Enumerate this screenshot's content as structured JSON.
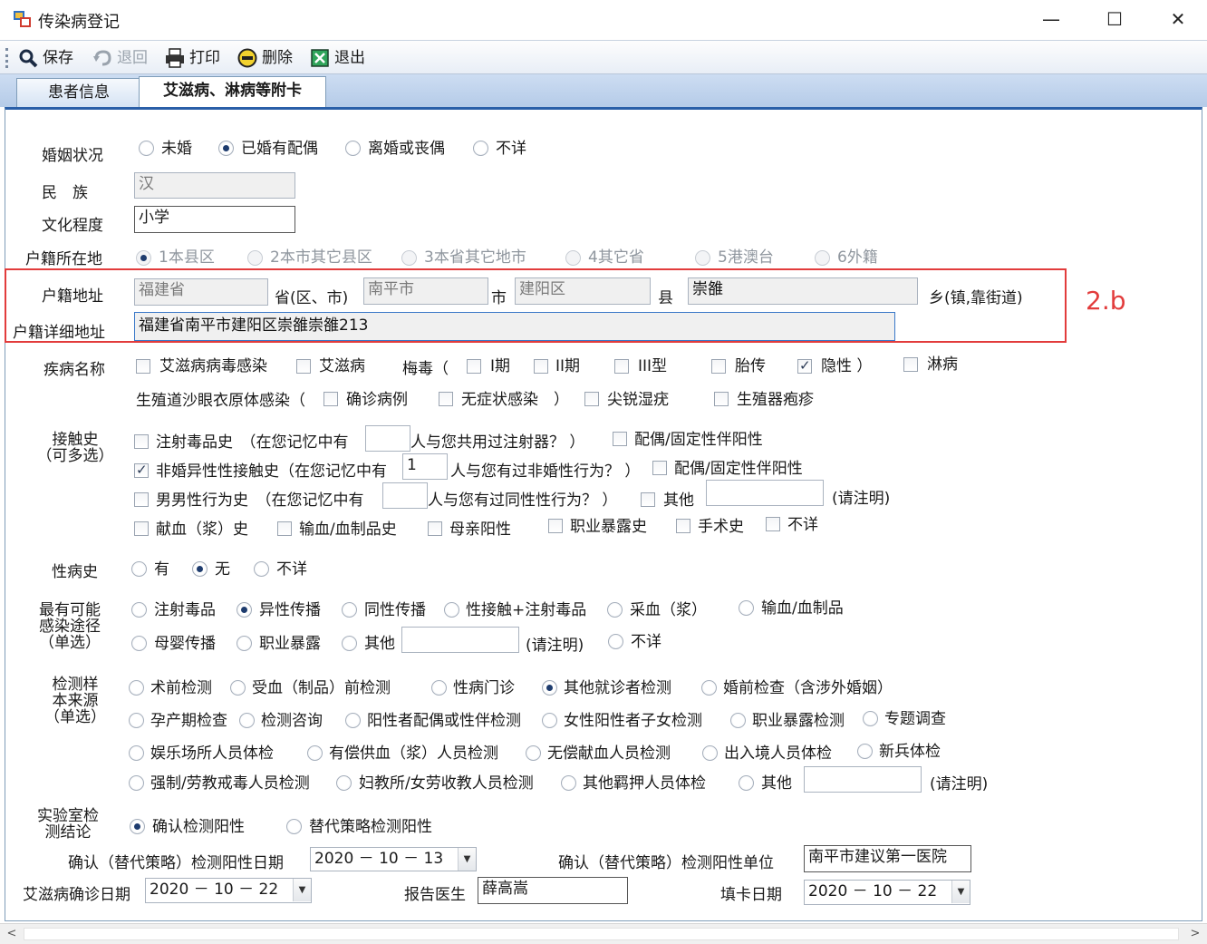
{
  "window": {
    "title": "传染病登记",
    "controls": {
      "minimize": "—",
      "maximize": "☐",
      "close": "✕"
    }
  },
  "toolbar": {
    "save": "保存",
    "back": "退回",
    "print": "打印",
    "delete": "删除",
    "exit": "退出"
  },
  "tabs": [
    {
      "label": "患者信息"
    },
    {
      "label": "艾滋病、淋病等附卡"
    }
  ],
  "annotation": "2.b",
  "form": {
    "marital": {
      "label": "婚姻状况",
      "options": [
        "未婚",
        "已婚有配偶",
        "离婚或丧偶",
        "不详"
      ],
      "selected": "已婚有配偶"
    },
    "ethnicity": {
      "label": "民　族",
      "value": "汉"
    },
    "education": {
      "label": "文化程度",
      "value": "小学"
    },
    "household_location": {
      "label": "户籍所在地",
      "options": [
        "1本县区",
        "2本市其它县区",
        "3本省其它地市",
        "4其它省",
        "5港澳台",
        "6外籍"
      ],
      "selected": "1本县区"
    },
    "household_address": {
      "label": "户籍地址",
      "province": "福建省",
      "province_suffix": "省(区、市)",
      "city": "南平市",
      "city_suffix": "市",
      "county": "建阳区",
      "county_suffix": "县",
      "town": "崇雒",
      "town_suffix": "乡(镇,靠街道)"
    },
    "household_detail": {
      "label": "户籍详细地址",
      "value": "福建省南平市建阳区崇雒崇雒213"
    },
    "disease": {
      "label": "疾病名称",
      "hiv_infection": "艾滋病病毒感染",
      "aids": "艾滋病",
      "syphilis": "梅毒（",
      "stage1": "I期",
      "stage2": "II期",
      "stage3": "III型",
      "fetal": "胎传",
      "latent": "隐性 ）",
      "gonorrhea": "淋病",
      "chlamydia": "生殖道沙眼衣原体感染（",
      "confirmed": "确诊病例",
      "asymptomatic": "无症状感染　）",
      "condyloma": "尖锐湿疣",
      "herpes": "生殖器疱疹"
    },
    "contact": {
      "label1": "接触史",
      "label2": "（可多选）",
      "injection": "注射毒品史　（在您记忆中有",
      "injection_q": "人与您共用过注射器？ ）",
      "spouse_pos1": "配偶/固定性伴阳性",
      "hetero": "非婚异性性接触史（在您记忆中有",
      "hetero_count": "1",
      "hetero_q": "人与您有过非婚性行为？ ）",
      "spouse_pos2": "配偶/固定性伴阳性",
      "msm": "男男性行为史　（在您记忆中有",
      "msm_q": "人与您有过同性性行为？ ）",
      "other": "其他",
      "other_note": "(请注明)",
      "blood_donation": "献血（浆）史",
      "transfusion": "输血/血制品史",
      "mother_pos": "母亲阳性",
      "occupational": "职业暴露史",
      "surgery": "手术史",
      "unknown": "不详"
    },
    "std_history": {
      "label": "性病史",
      "options": [
        "有",
        "无",
        "不详"
      ],
      "selected": "无"
    },
    "route": {
      "label1": "最有可能",
      "label2": "感染途径",
      "label3": "（单选）",
      "options_row1": [
        "注射毒品",
        "异性传播",
        "同性传播",
        "性接触+注射毒品",
        "采血（浆）",
        "输血/血制品"
      ],
      "options_row2": [
        "母婴传播",
        "职业暴露",
        "其他"
      ],
      "note": "(请注明)",
      "unknown": "不详",
      "selected": "异性传播"
    },
    "sample_source": {
      "label1": "检测样",
      "label2": "本来源",
      "label3": "（单选）",
      "row1": [
        "术前检测",
        "受血（制品）前检测",
        "性病门诊",
        "其他就诊者检测",
        "婚前检查（含涉外婚姻）"
      ],
      "row2": [
        "孕产期检查",
        "检测咨询",
        "阳性者配偶或性伴检测",
        "女性阳性者子女检测",
        "职业暴露检测",
        "专题调查"
      ],
      "row3": [
        "娱乐场所人员体检",
        "有偿供血（浆）人员检测",
        "无偿献血人员检测",
        "出入境人员体检",
        "新兵体检"
      ],
      "row4": [
        "强制/劳教戒毒人员检测",
        "妇教所/女劳收教人员检测",
        "其他羁押人员体检",
        "其他"
      ],
      "note": "(请注明)",
      "selected": "其他就诊者检测"
    },
    "lab": {
      "label1": "实验室检",
      "label2": "测结论",
      "options": [
        "确认检测阳性",
        "替代策略检测阳性"
      ],
      "selected": "确认检测阳性"
    },
    "confirm_date": {
      "label": "确认（替代策略）检测阳性日期",
      "value": "2020 － 10 － 13"
    },
    "confirm_unit": {
      "label": "确认（替代策略）检测阳性单位",
      "value": "南平市建议第一医院"
    },
    "diagnosis_date": {
      "label": "艾滋病确诊日期",
      "value": "2020 － 10 － 22"
    },
    "doctor": {
      "label": "报告医生",
      "value": "薛高嵩"
    },
    "fill_date": {
      "label": "填卡日期",
      "value": "2020 － 10 － 22"
    }
  }
}
